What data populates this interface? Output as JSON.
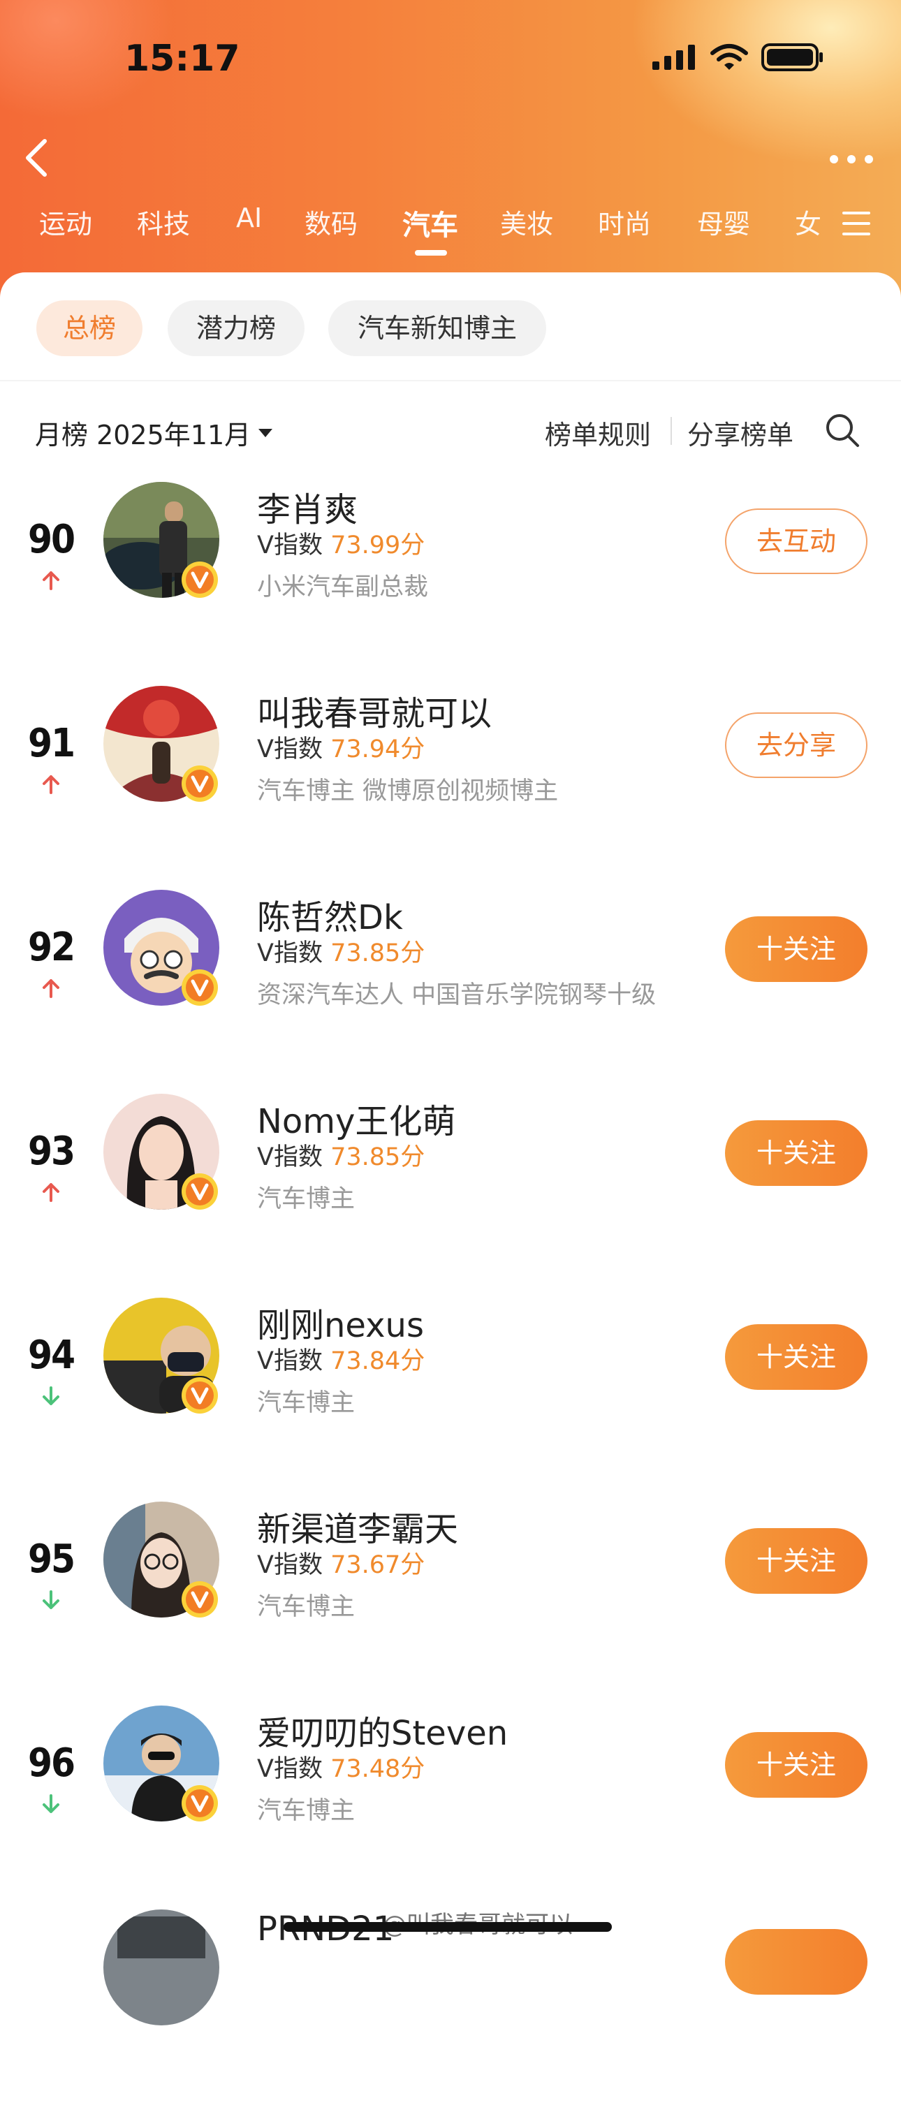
{
  "status_bar": {
    "time": "15:17"
  },
  "category_tabs": [
    "运动",
    "科技",
    "AI",
    "数码",
    "汽车",
    "美妆",
    "时尚",
    "母婴",
    "女"
  ],
  "active_category": "汽车",
  "sub_tabs": [
    "总榜",
    "潜力榜",
    "汽车新知博主"
  ],
  "active_sub_tab": "总榜",
  "toolbar": {
    "period": "月榜 2025年11月",
    "rules": "榜单规则",
    "share": "分享榜单"
  },
  "index_label": "V指数",
  "items": [
    {
      "rank": "90",
      "trend": "up",
      "name": "李肖爽",
      "score": "73.99分",
      "desc": "小米汽车副总裁",
      "action": "去互动"
    },
    {
      "rank": "91",
      "trend": "up",
      "name": "叫我春哥就可以",
      "score": "73.94分",
      "desc": "汽车博主 微博原创视频博主",
      "action": "去分享"
    },
    {
      "rank": "92",
      "trend": "up",
      "name": "陈哲然Dk",
      "score": "73.85分",
      "desc": "资深汽车达人 中国音乐学院钢琴十级",
      "action": "十关注"
    },
    {
      "rank": "93",
      "trend": "up",
      "name": "Nomy王化萌",
      "score": "73.85分",
      "desc": "汽车博主",
      "action": "十关注"
    },
    {
      "rank": "94",
      "trend": "down",
      "name": "刚刚nexus",
      "score": "73.84分",
      "desc": "汽车博主",
      "action": "十关注"
    },
    {
      "rank": "95",
      "trend": "down",
      "name": "新渠道李霸天",
      "score": "73.67分",
      "desc": "汽车博主",
      "action": "十关注"
    },
    {
      "rank": "96",
      "trend": "down",
      "name": "爱叨叨的Steven",
      "score": "73.48分",
      "desc": "汽车博主",
      "action": "十关注"
    },
    {
      "rank": "",
      "trend": "",
      "name": "PRND21",
      "score": "",
      "desc": "",
      "action": ""
    }
  ],
  "watermark": "@叫我春哥就可以",
  "colors": {
    "accent": "#f07d2e",
    "up": "#e8594f",
    "down": "#4cc27a",
    "score": "#f08a2c"
  }
}
